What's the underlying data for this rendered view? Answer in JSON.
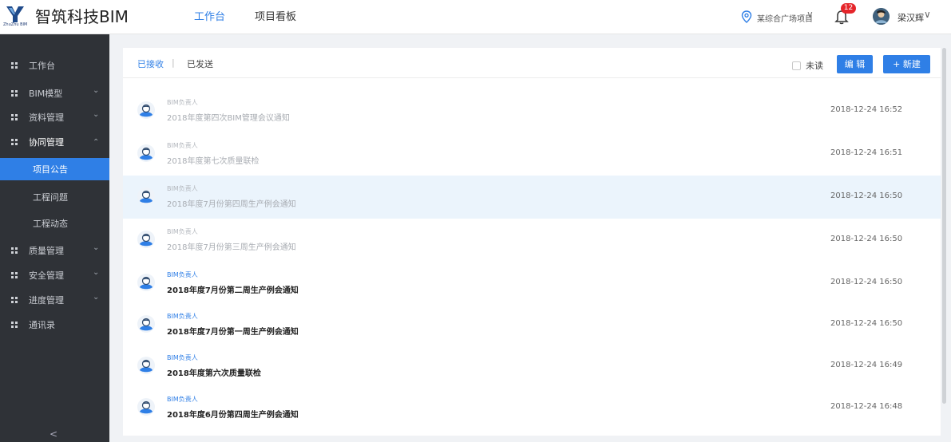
{
  "brand": {
    "name": "智筑科技BIM",
    "logo_sub": "ZhuZhu BIM"
  },
  "nav": [
    {
      "label": "工作台",
      "active": true
    },
    {
      "label": "项目看板",
      "active": false
    }
  ],
  "header": {
    "location": "某综合广场项目",
    "location_arrow": "∨",
    "notifications": "12",
    "user": "梁汉辉",
    "user_arrow": "∨"
  },
  "sidebar": {
    "items": [
      {
        "label": "工作台"
      },
      {
        "label": "BIM模型",
        "chev": "⌄"
      },
      {
        "label": "资料管理",
        "chev": "⌄"
      },
      {
        "label": "协同管理",
        "chev": "⌃"
      },
      {
        "label": "质量管理",
        "chev": "⌄"
      },
      {
        "label": "安全管理",
        "chev": "⌄"
      },
      {
        "label": "进度管理",
        "chev": "⌄"
      },
      {
        "label": "通讯录"
      }
    ],
    "sub": [
      {
        "label": "项目公告",
        "active": true
      },
      {
        "label": "工程问题"
      },
      {
        "label": "工程动态"
      }
    ],
    "collapse": "<"
  },
  "tabs": {
    "received": "已接收",
    "separator": "|",
    "sent": "已发送"
  },
  "toolbar": {
    "unread": "未读",
    "edit": "编 辑",
    "new": "+ 新建"
  },
  "accent": "#2f7fe6",
  "messages": [
    {
      "sender": "BIM负责人",
      "title": "2018年度第四次BIM管理会议通知",
      "time": "2018-12-24 16:52",
      "read": true
    },
    {
      "sender": "BIM负责人",
      "title": "2018年度第七次质量联检",
      "time": "2018-12-24 16:51",
      "read": true
    },
    {
      "sender": "BIM负责人",
      "title": "2018年度7月份第四周生产例会通知",
      "time": "2018-12-24 16:50",
      "read": true,
      "highlight": true
    },
    {
      "sender": "BIM负责人",
      "title": "2018年度7月份第三周生产例会通知",
      "time": "2018-12-24 16:50",
      "read": true
    },
    {
      "sender": "BIM负责人",
      "title": "2018年度7月份第二周生产例会通知",
      "time": "2018-12-24 16:50",
      "read": false
    },
    {
      "sender": "BIM负责人",
      "title": "2018年度7月份第一周生产例会通知",
      "time": "2018-12-24 16:50",
      "read": false
    },
    {
      "sender": "BIM负责人",
      "title": "2018年度第六次质量联检",
      "time": "2018-12-24 16:49",
      "read": false
    },
    {
      "sender": "BIM负责人",
      "title": "2018年度6月份第四周生产例会通知",
      "time": "2018-12-24 16:48",
      "read": false
    }
  ]
}
